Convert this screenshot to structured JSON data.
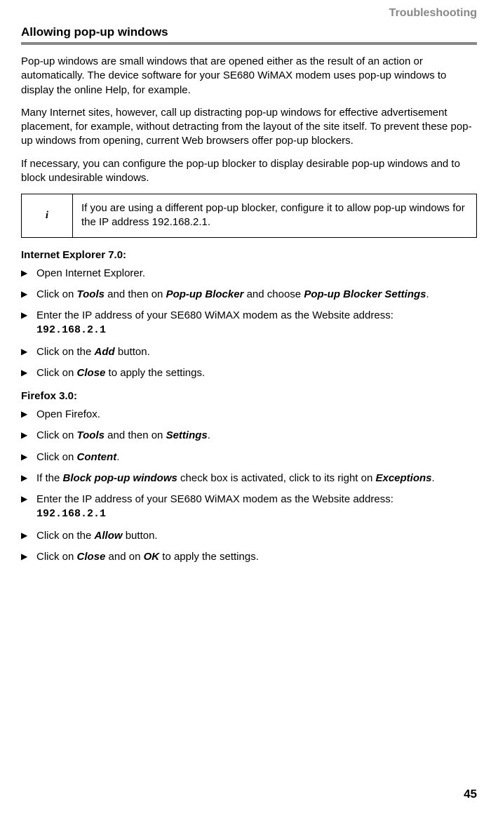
{
  "header": {
    "label": "Troubleshooting"
  },
  "section": {
    "title": "Allowing pop-up windows"
  },
  "paragraphs": {
    "p1": "Pop-up windows are small windows that are opened either as the result of an action or automatically. The device software for your SE680 WiMAX modem uses pop-up windows to display the online Help, for example.",
    "p2": "Many Internet sites, however, call up distracting pop-up windows for effective advertisement placement, for example, without detracting from the layout of the site itself. To prevent these pop-up windows from opening, current Web browsers offer pop-up blockers.",
    "p3": "If necessary, you can configure the pop-up blocker to display desirable pop-up windows and to block undesirable windows."
  },
  "note": {
    "icon": "i",
    "text": "If you are using a different pop-up blocker, configure it to allow pop-up windows for the IP address 192.168.2.1."
  },
  "ie": {
    "heading": "Internet Explorer 7.0:",
    "steps": [
      {
        "text": "Open Internet Explorer."
      },
      {
        "pre": "Click on ",
        "b1": "Tools",
        "mid1": " and then on ",
        "b2": "Pop-up Blocker",
        "mid2": " and choose ",
        "b3": "Pop-up Blocker Settings",
        "post": "."
      },
      {
        "text": "Enter the IP address of your SE680 WiMAX modem as the Website address:",
        "code": "192.168.2.1"
      },
      {
        "pre": "Click on the ",
        "b1": "Add",
        "post": " button."
      },
      {
        "pre": "Click on ",
        "b1": "Close",
        "post": " to apply the settings."
      }
    ]
  },
  "ff": {
    "heading": "Firefox 3.0:",
    "steps": [
      {
        "text": "Open Firefox."
      },
      {
        "pre": "Click on ",
        "b1": "Tools",
        "mid1": " and then on ",
        "b2": "Settings",
        "post": "."
      },
      {
        "pre": "Click on ",
        "b1": "Content",
        "post": "."
      },
      {
        "pre": "If the ",
        "b1": "Block pop-up windows",
        "mid1": " check box is activated, click to its right on ",
        "b2": "Exceptions",
        "post": "."
      },
      {
        "text": "Enter the IP address of your SE680 WiMAX modem as the Website address:",
        "code": "192.168.2.1"
      },
      {
        "pre": "Click on the ",
        "b1": "Allow",
        "post": " button."
      },
      {
        "pre": "Click on ",
        "b1": "Close",
        "mid1": " and on ",
        "b2": "OK",
        "post": " to apply the settings."
      }
    ]
  },
  "footer": {
    "page": "45"
  }
}
